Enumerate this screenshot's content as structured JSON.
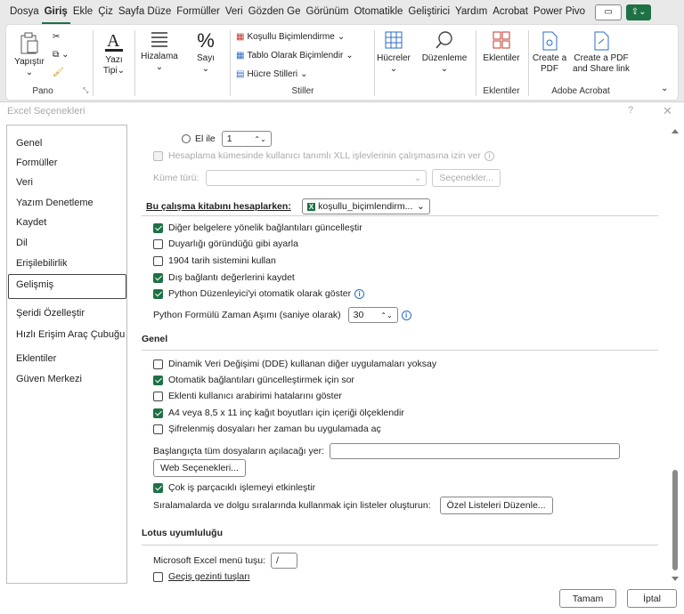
{
  "ribbon_tabs": [
    "Dosya",
    "Giriş",
    "Ekle",
    "Çiz",
    "Sayfa Düze",
    "Formüller",
    "Veri",
    "Gözden Ge",
    "Görünüm",
    "Otomatikle",
    "Geliştirici",
    "Yardım",
    "Acrobat",
    "Power Pivo"
  ],
  "active_tab": "Giriş",
  "ribbon": {
    "paste": "Yapıştır",
    "font": "Yazı Tipi",
    "alignment": "Hizalama",
    "number": "Sayı",
    "cond_format": "Koşullu Biçimlendirme",
    "format_table": "Tablo Olarak Biçimlendir",
    "cell_styles": "Hücre Stilleri",
    "cells": "Hücreler",
    "editing": "Düzenleme",
    "addins": "Eklentiler",
    "create_pdf": "Create a PDF",
    "create_share": "Create a PDF and Share link",
    "group_pano": "Pano",
    "group_stiller": "Stiller",
    "group_eklentiler": "Eklentiler",
    "group_adobe": "Adobe Acrobat"
  },
  "dialog_title": "Excel Seçenekleri",
  "help_glyph": "?",
  "close_glyph": "✕",
  "nav": [
    "Genel",
    "Formüller",
    "Veri",
    "Yazım Denetleme",
    "Kaydet",
    "Dil",
    "Erişilebilirlik",
    "Gelişmiş",
    "Şeridi Özelleştir",
    "Hızlı Erişim Araç Çubuğu",
    "Eklentiler",
    "Güven Merkezi"
  ],
  "nav_selected": "Gelişmiş",
  "content": {
    "manual_radio": "El ile",
    "manual_value": "1",
    "xll_option": "Hesaplama kümesinde kullanıcı tanımlı XLL işlevlerinin çalışmasına izin ver",
    "cluster_type_label": "Küme türü:",
    "options_button": "Seçenekler...",
    "workbook_calc_heading": "Bu çalışma kitabını hesaplarken:",
    "workbook_name": "koşullu_biçimlendirm...",
    "wb_options": [
      {
        "label": "Diğer belgelere yönelik bağlantıları güncelleştir",
        "checked": true
      },
      {
        "label": "Duyarlığı göründüğü gibi ayarla",
        "checked": false
      },
      {
        "label": "1904 tarih sistemini kullan",
        "checked": false
      },
      {
        "label": "Dış bağlantı değerlerini kaydet",
        "checked": true
      },
      {
        "label": "Python Düzenleyici'yi otomatik olarak göster",
        "checked": true
      }
    ],
    "python_timeout_label": "Python Formülü Zaman Aşımı (saniye olarak)",
    "python_timeout_value": "30",
    "general_heading": "Genel",
    "general_options": [
      {
        "label": "Dinamik Veri Değişimi (DDE) kullanan diğer uygulamaları yoksay",
        "checked": false
      },
      {
        "label": "Otomatik bağlantıları güncelleştirmek için sor",
        "checked": true
      },
      {
        "label": "Eklenti kullanıcı arabirimi hatalarını göster",
        "checked": false
      },
      {
        "label": "A4 veya 8,5 x 11 inç kağıt boyutları için içeriği ölçeklendir",
        "checked": true
      },
      {
        "label": "Şifrelenmiş dosyaları her zaman bu uygulamada aç",
        "checked": false
      }
    ],
    "startup_label": "Başlangıçta tüm dosyaların açılacağı yer:",
    "startup_value": "",
    "web_options_button": "Web Seçenekleri...",
    "multithread_label": "Çok iş parçacıklı işlemeyi etkinleştir",
    "multithread_checked": true,
    "custom_lists_label": "Sıralamalarda ve dolgu sıralarında kullanmak için listeler oluşturun:",
    "custom_lists_button": "Özel Listeleri Düzenle...",
    "lotus_heading": "Lotus uyumluluğu",
    "menu_key_label": "Microsoft Excel menü tuşu:",
    "menu_key_value": "/",
    "nav_keys_label": "Geçiş gezinti tuşları",
    "nav_keys_checked": false
  },
  "footer": {
    "ok": "Tamam",
    "cancel": "İptal"
  },
  "colors": {
    "accent": "#1e7145",
    "info": "#2b6cc4"
  }
}
